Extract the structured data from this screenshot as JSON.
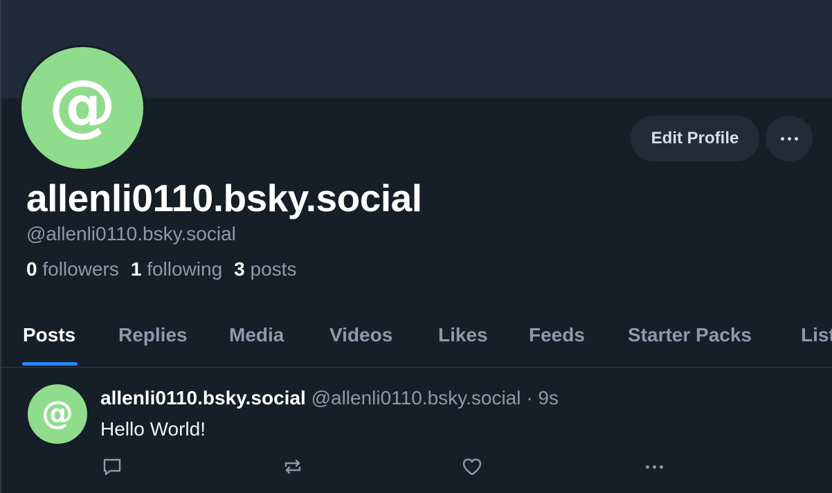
{
  "profile": {
    "avatar_glyph": "@",
    "display_name": "allenli0110.bsky.social",
    "handle": "@allenli0110.bsky.social",
    "edit_profile_label": "Edit Profile",
    "more_icon": "more-horizontal-icon",
    "stats": {
      "followers_count": "0",
      "followers_label": "followers",
      "following_count": "1",
      "following_label": "following",
      "posts_count": "3",
      "posts_label": "posts"
    }
  },
  "tabs": [
    {
      "label": "Posts",
      "active": true
    },
    {
      "label": "Replies",
      "active": false
    },
    {
      "label": "Media",
      "active": false
    },
    {
      "label": "Videos",
      "active": false
    },
    {
      "label": "Likes",
      "active": false
    },
    {
      "label": "Feeds",
      "active": false
    },
    {
      "label": "Starter Packs",
      "active": false
    },
    {
      "label": "Lists",
      "active": false
    }
  ],
  "post": {
    "avatar_glyph": "@",
    "author": "allenli0110.bsky.social",
    "handle": "@allenli0110.bsky.social",
    "separator": "·",
    "time": "9s",
    "text": "Hello World!",
    "actions": [
      "reply-icon",
      "repost-icon",
      "like-icon",
      "more-horizontal-icon"
    ]
  },
  "colors": {
    "background": "#161e27",
    "banner": "#212a38",
    "avatar": "#8fdc8d",
    "muted_text": "#8d9aab",
    "accent": "#2a84ff",
    "button_bg": "#222c39"
  }
}
